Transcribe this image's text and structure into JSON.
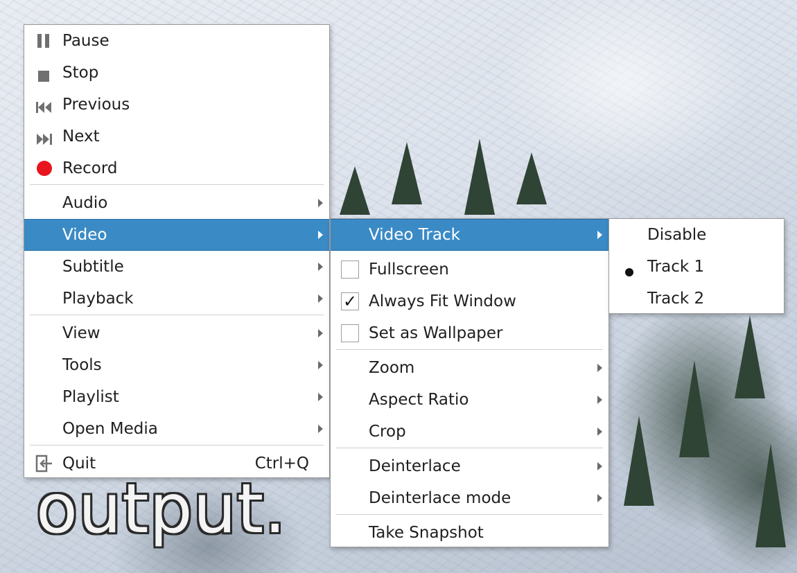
{
  "overlay_text": "output.",
  "main_menu": {
    "items": [
      {
        "label": "Pause",
        "icon": "pause-icon"
      },
      {
        "label": "Stop",
        "icon": "stop-icon"
      },
      {
        "label": "Previous",
        "icon": "previous-icon"
      },
      {
        "label": "Next",
        "icon": "next-icon"
      },
      {
        "label": "Record",
        "icon": "record-icon"
      },
      {
        "label": "Audio"
      },
      {
        "label": "Video"
      },
      {
        "label": "Subtitle"
      },
      {
        "label": "Playback"
      },
      {
        "label": "View"
      },
      {
        "label": "Tools"
      },
      {
        "label": "Playlist"
      },
      {
        "label": "Open Media"
      },
      {
        "label": "Quit",
        "icon": "quit-icon",
        "shortcut": "Ctrl+Q"
      }
    ]
  },
  "video_menu": {
    "items": [
      {
        "label": "Video Track"
      },
      {
        "label": "Fullscreen",
        "checked": false
      },
      {
        "label": "Always Fit Window",
        "checked": true,
        "check_mark": "✓"
      },
      {
        "label": "Set as Wallpaper",
        "checked": false
      },
      {
        "label": "Zoom"
      },
      {
        "label": "Aspect Ratio"
      },
      {
        "label": "Crop"
      },
      {
        "label": "Deinterlace"
      },
      {
        "label": "Deinterlace mode"
      },
      {
        "label": "Take Snapshot"
      }
    ]
  },
  "track_menu": {
    "items": [
      {
        "label": "Disable",
        "selected": false
      },
      {
        "label": "Track 1",
        "selected": true
      },
      {
        "label": "Track 2",
        "selected": false
      }
    ]
  },
  "colors": {
    "highlight": "#3a8ac6",
    "record": "#e8141e",
    "icon_gray": "#707070"
  }
}
